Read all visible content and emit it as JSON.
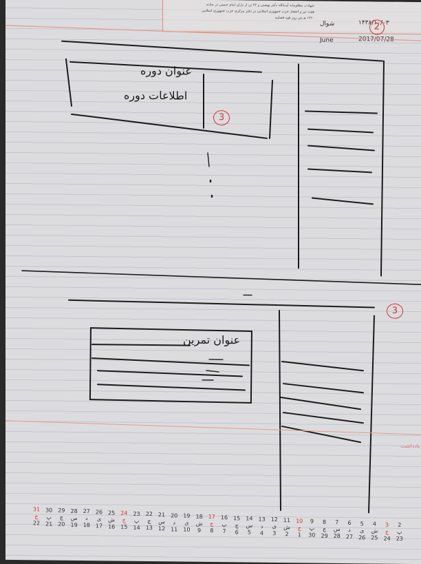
{
  "header": {
    "month_label": "شوال",
    "hijri_date": "۱۴۳۸/۱۰/۰۳",
    "gregorian_month": "June",
    "gregorian_date": "2017/07/28",
    "note_line1": "شهادت مظلومانه آیت‌الله دکتر بهشتی و ۷۲ تن از یاران امام خمینی در حادثه",
    "note_line2": "هفت تیر و انفجار حزب جمهوری اسلامی در دفتر مرکزی حزب جمهوری اسلامی",
    "note_line3": "۱۳۶۰ هـ.ش روز قوه قضاییه",
    "circle_number": "2"
  },
  "sketch_top": {
    "circle_number": "3",
    "title_label": "عنوان دوره",
    "info_label": "اطلاعات دوره"
  },
  "sketch_bottom": {
    "circle_number": "3",
    "title_label": "عنوان تمرین"
  },
  "side_note": "یادداشت",
  "calendar": {
    "weekdays": [
      "ج",
      "پ",
      "چ",
      "س",
      "د",
      "ی",
      "ش",
      "ج",
      "پ",
      "چ",
      "س",
      "د",
      "ی",
      "ش",
      "ج",
      "پ",
      "چ",
      "س",
      "د",
      "ی",
      "ش",
      "ج",
      "پ",
      "چ",
      "س",
      "د",
      "ی",
      "ش",
      "ج",
      "پ"
    ],
    "days": [
      "31",
      "30",
      "29",
      "28",
      "27",
      "26",
      "25",
      "24",
      "23",
      "22",
      "21",
      "20",
      "19",
      "18",
      "17",
      "16",
      "15",
      "14",
      "13",
      "12",
      "11",
      "10",
      "9",
      "8",
      "7",
      "6",
      "5",
      "4",
      "3",
      "2"
    ],
    "gregorian": [
      "22",
      "21",
      "20",
      "19",
      "18",
      "17",
      "16",
      "15",
      "14",
      "13",
      "12",
      "11",
      "10",
      "9",
      "8",
      "7",
      "6",
      "5",
      "4",
      "3",
      "2",
      "1",
      "30",
      "29",
      "28",
      "27",
      "26",
      "25",
      "24",
      "23"
    ]
  }
}
